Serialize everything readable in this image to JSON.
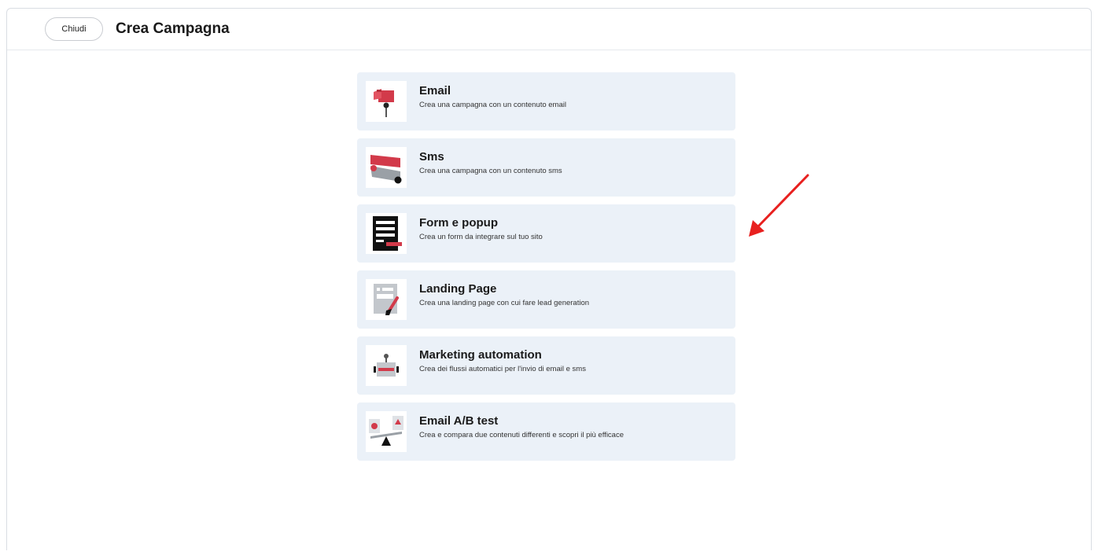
{
  "header": {
    "close_label": "Chiudi",
    "title": "Crea Campagna"
  },
  "options": [
    {
      "title": "Email",
      "description": "Crea una campagna con un contenuto email",
      "icon": "mailbox-icon"
    },
    {
      "title": "Sms",
      "description": "Crea una campagna con un contenuto sms",
      "icon": "sms-icon"
    },
    {
      "title": "Form e popup",
      "description": "Crea un form da integrare sul tuo sito",
      "icon": "form-icon"
    },
    {
      "title": "Landing Page",
      "description": "Crea una landing page con cui fare lead generation",
      "icon": "landing-page-icon"
    },
    {
      "title": "Marketing automation",
      "description": "Crea dei flussi automatici per l'invio di email e sms",
      "icon": "robot-icon"
    },
    {
      "title": "Email A/B test",
      "description": "Crea e compara due contenuti differenti e scopri il più efficace",
      "icon": "ab-test-icon"
    }
  ],
  "colors": {
    "accent": "#d23a4a",
    "card_background": "#ebf1f8",
    "annotation_arrow": "#e8201f"
  }
}
